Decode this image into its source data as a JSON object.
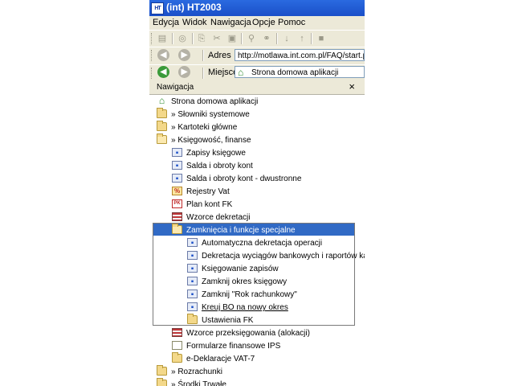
{
  "window": {
    "title": "(int)  HT2003"
  },
  "menu": [
    "Edycja",
    "Widok",
    "Nawigacja",
    "Opcje",
    "Pomoc"
  ],
  "address_bar": {
    "label": "Adres",
    "value": "http://motlawa.int.com.pl/FAQ/start.php?"
  },
  "location_bar": {
    "label": "Miejsce",
    "value": "Strona domowa aplikacji"
  },
  "nav_panel": {
    "title": "Nawigacja",
    "close": "×"
  },
  "tree": [
    {
      "label": "Strona domowa aplikacji",
      "icon": "home-icon"
    },
    {
      "label": "» Słowniki systemowe",
      "icon": "folder-icon"
    },
    {
      "label": "» Kartoteki główne",
      "icon": "folder-icon"
    },
    {
      "label": "» Księgowość, finanse",
      "icon": "folder-open-icon"
    },
    {
      "label": "Zapisy księgowe",
      "icon": "app-icon"
    },
    {
      "label": "Salda i obroty kont",
      "icon": "app-icon"
    },
    {
      "label": "Salda i obroty kont - dwustronne",
      "icon": "app-icon"
    },
    {
      "label": "Rejestry Vat",
      "icon": "vat-icon"
    },
    {
      "label": "Plan kont FK",
      "icon": "plan-kont-icon"
    },
    {
      "label": "Wzorce dekretacji",
      "icon": "template-icon"
    },
    {
      "label": "Zamknięcia i funkcje specjalne",
      "icon": "folder-open-icon",
      "selected": true
    },
    {
      "label": "Automatyczna dekretacja operacji",
      "icon": "app-icon"
    },
    {
      "label": "Dekretacja wyciągów bankowych i raportów kas...",
      "icon": "app-icon"
    },
    {
      "label": "Księgowanie zapisów",
      "icon": "app-icon"
    },
    {
      "label": "Zamknij okres księgowy",
      "icon": "app-icon"
    },
    {
      "label": "Zamknij \"Rok rachunkowy\"",
      "icon": "app-icon"
    },
    {
      "label": "Kreuj BO na nowy okres",
      "icon": "app-icon",
      "underline": true
    },
    {
      "label": "Ustawienia FK",
      "icon": "folder-icon"
    },
    {
      "label": "Wzorce przeksięgowania (alokacji)",
      "icon": "template-icon"
    },
    {
      "label": "Formularze finansowe IPS",
      "icon": "document-icon"
    },
    {
      "label": "e-Deklaracje VAT-7",
      "icon": "folder-icon"
    },
    {
      "label": "» Rozrachunki",
      "icon": "folder-icon"
    },
    {
      "label": "» Środki Trwałe",
      "icon": "folder-icon"
    }
  ],
  "colors": {
    "titlebar": "#1a4fc8",
    "selection": "#316ac5",
    "folder": "#f3d88a"
  }
}
